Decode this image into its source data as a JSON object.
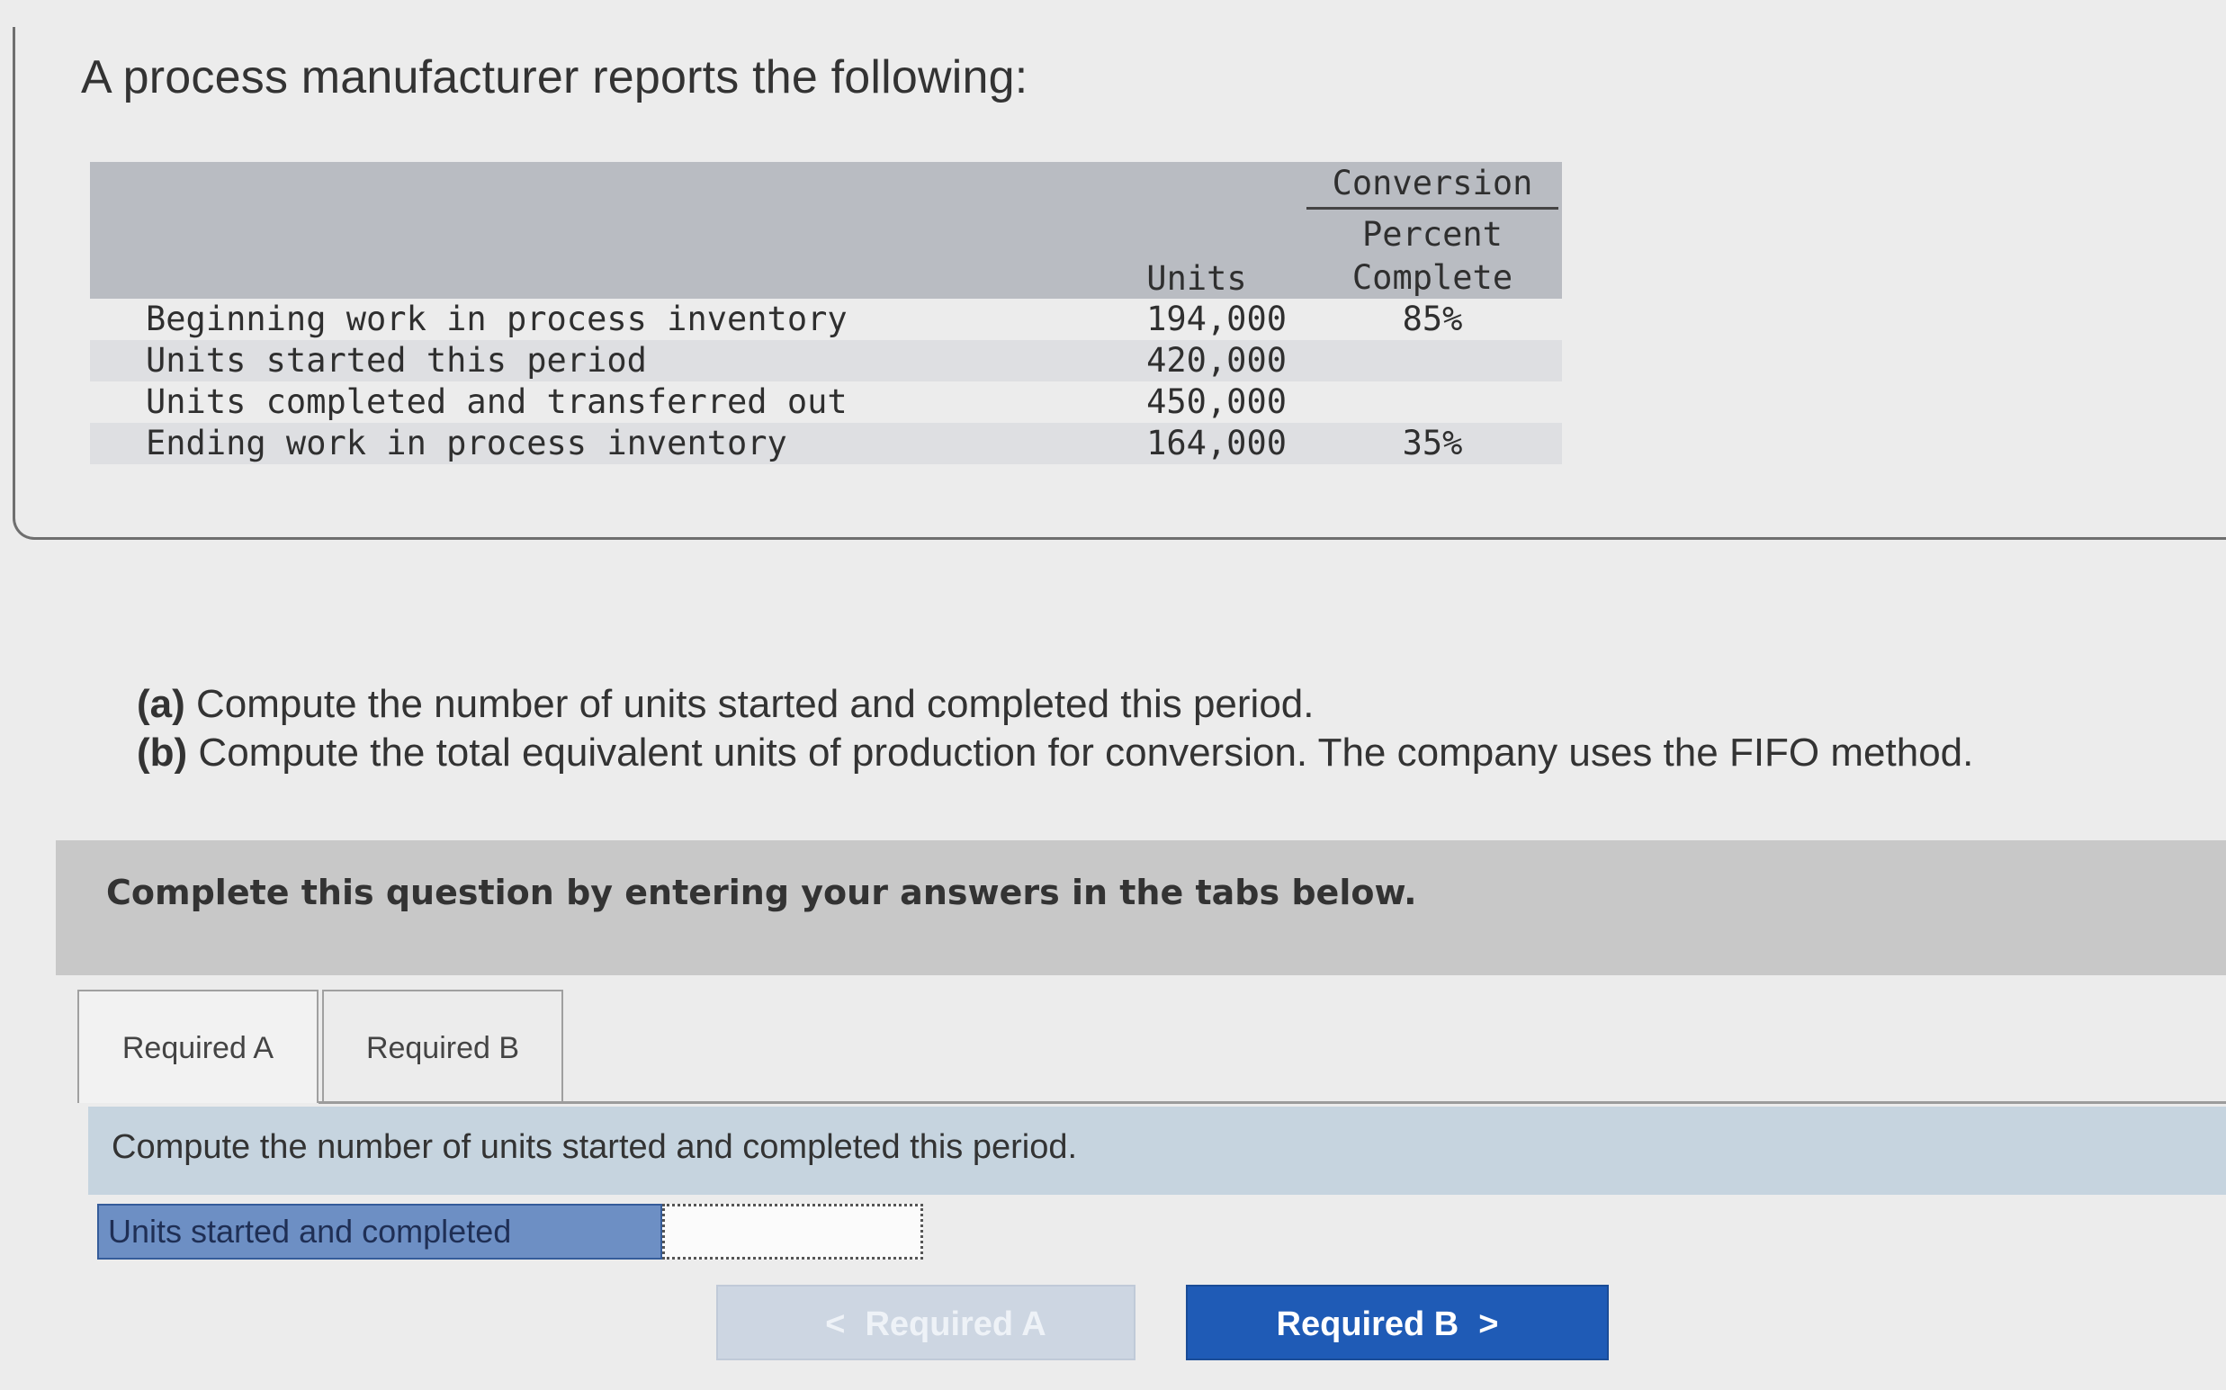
{
  "problem": {
    "intro": "A process manufacturer reports the following:",
    "table": {
      "col_units": "Units",
      "col_conversion_title": "Conversion",
      "col_conversion_line2": "Percent",
      "col_conversion_line3": "Complete",
      "rows": [
        {
          "label": "Beginning work in process inventory",
          "units": "194,000",
          "pct": "85%"
        },
        {
          "label": "Units started this period",
          "units": "420,000",
          "pct": ""
        },
        {
          "label": "Units completed and transferred out",
          "units": "450,000",
          "pct": ""
        },
        {
          "label": "Ending work in process inventory",
          "units": "164,000",
          "pct": "35%"
        }
      ]
    }
  },
  "questions": {
    "a_tag": "(a)",
    "a_text": "Compute the number of units started and completed this period.",
    "b_tag": "(b)",
    "b_text": "Compute the total equivalent units of production for conversion. The company uses the FIFO method."
  },
  "instruction": "Complete this question by entering your answers in the tabs below.",
  "tabs": [
    {
      "label": "Required A",
      "active": true
    },
    {
      "label": "Required B",
      "active": false
    }
  ],
  "answer": {
    "prompt": "Compute the number of units started and completed this period.",
    "field_label": "Units started and completed",
    "field_value": ""
  },
  "nav": {
    "prev_label": "Required A",
    "next_label": "Required B",
    "prev_icon": "chevron-left-icon",
    "next_icon": "chevron-right-icon"
  },
  "colors": {
    "accent": "#1f5bb6",
    "label_bg": "#6d8fc4",
    "strip_bg": "#c6d4df"
  }
}
